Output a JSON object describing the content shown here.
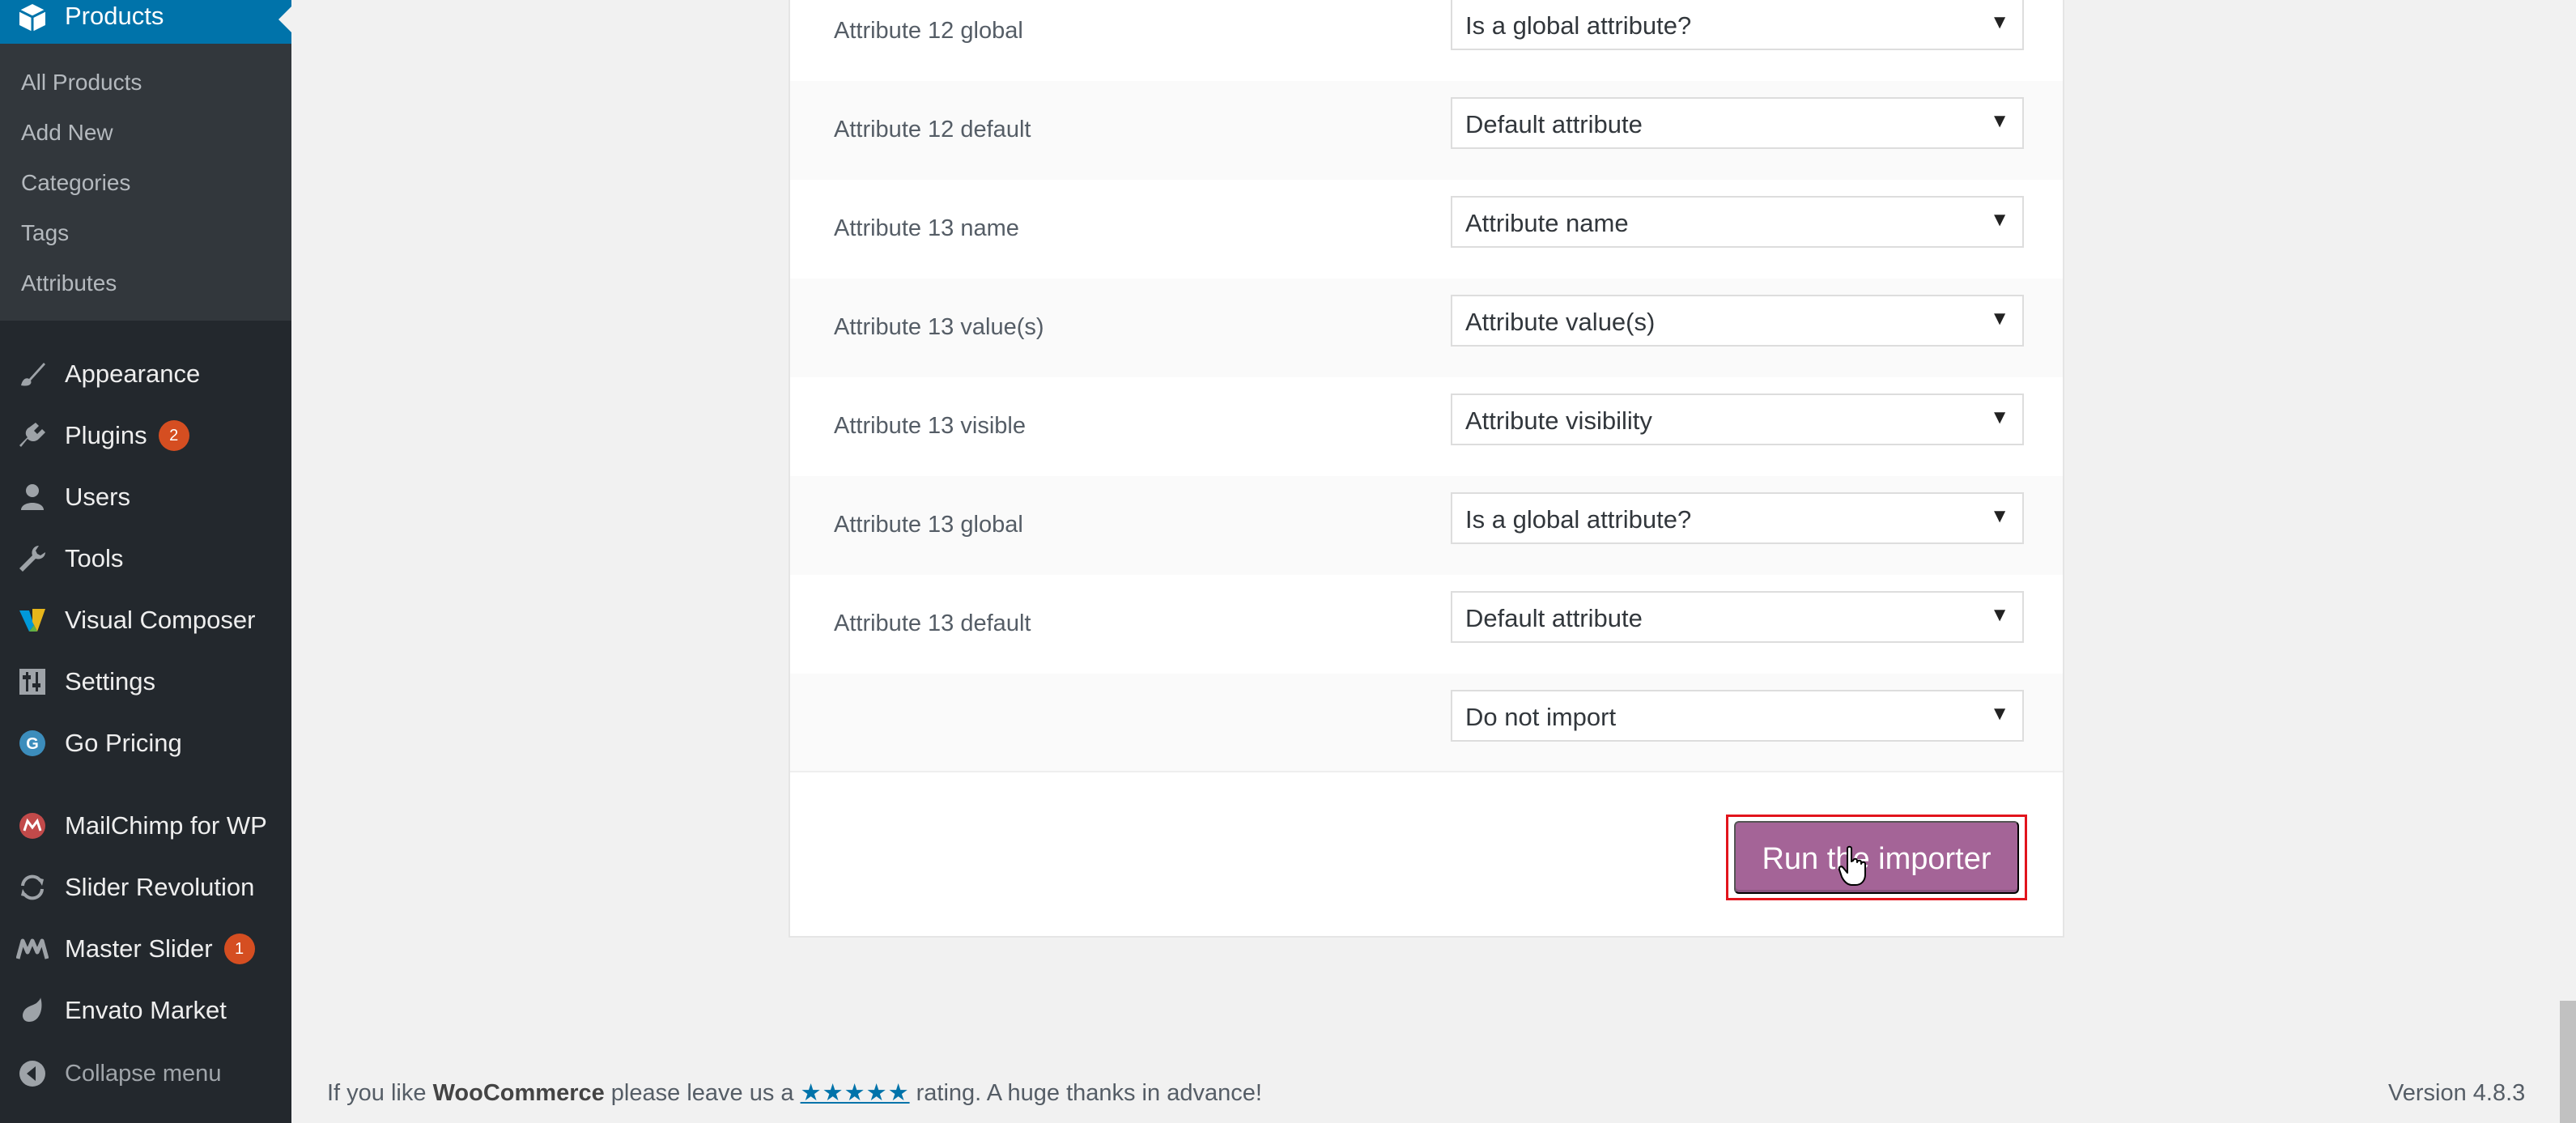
{
  "sidebar": {
    "active": {
      "label": "Products",
      "icon": "box-icon"
    },
    "submenu": [
      {
        "label": "All Products"
      },
      {
        "label": "Add New"
      },
      {
        "label": "Categories"
      },
      {
        "label": "Tags"
      },
      {
        "label": "Attributes"
      }
    ],
    "items": [
      {
        "label": "Appearance",
        "icon": "paintbrush-icon"
      },
      {
        "label": "Plugins",
        "icon": "plug-icon",
        "badge": "2"
      },
      {
        "label": "Users",
        "icon": "user-icon"
      },
      {
        "label": "Tools",
        "icon": "wrench-icon"
      },
      {
        "label": "Visual Composer",
        "icon": "visual-composer-icon"
      },
      {
        "label": "Settings",
        "icon": "settings-sliders-icon"
      },
      {
        "label": "Go Pricing",
        "icon": "go-pricing-icon"
      },
      {
        "label": "MailChimp for WP",
        "icon": "mailchimp-icon"
      },
      {
        "label": "Slider Revolution",
        "icon": "refresh-icon"
      },
      {
        "label": "Master Slider",
        "icon": "master-slider-icon",
        "badge": "1"
      },
      {
        "label": "Envato Market",
        "icon": "leaf-icon"
      },
      {
        "label": "Collapse menu",
        "icon": "collapse-arrow-icon"
      }
    ]
  },
  "mapping": {
    "rows": [
      {
        "label": "Attribute 12 global",
        "select": "Is a global attribute?"
      },
      {
        "label": "Attribute 12 default",
        "select": "Default attribute"
      },
      {
        "label": "Attribute 13 name",
        "select": "Attribute name"
      },
      {
        "label": "Attribute 13 value(s)",
        "select": "Attribute value(s)"
      },
      {
        "label": "Attribute 13 visible",
        "select": "Attribute visibility"
      },
      {
        "label": "Attribute 13 global",
        "select": "Is a global attribute?"
      },
      {
        "label": "Attribute 13 default",
        "select": "Default attribute"
      },
      {
        "label": "",
        "select": "Do not import"
      }
    ],
    "run_button": "Run the importer"
  },
  "footer": {
    "text_before": "If you like ",
    "brand": "WooCommerce",
    "text_middle": " please leave us a ",
    "stars": "★★★★★",
    "text_after": " rating. A huge thanks in advance!",
    "version": "Version 4.8.3"
  },
  "colors": {
    "sidebar_bg": "#23282d",
    "submenu_bg": "#32373c",
    "active_bg": "#0073aa",
    "button_bg": "#a46497",
    "badge_bg": "#d54e21",
    "highlight_border": "#e2141c"
  }
}
